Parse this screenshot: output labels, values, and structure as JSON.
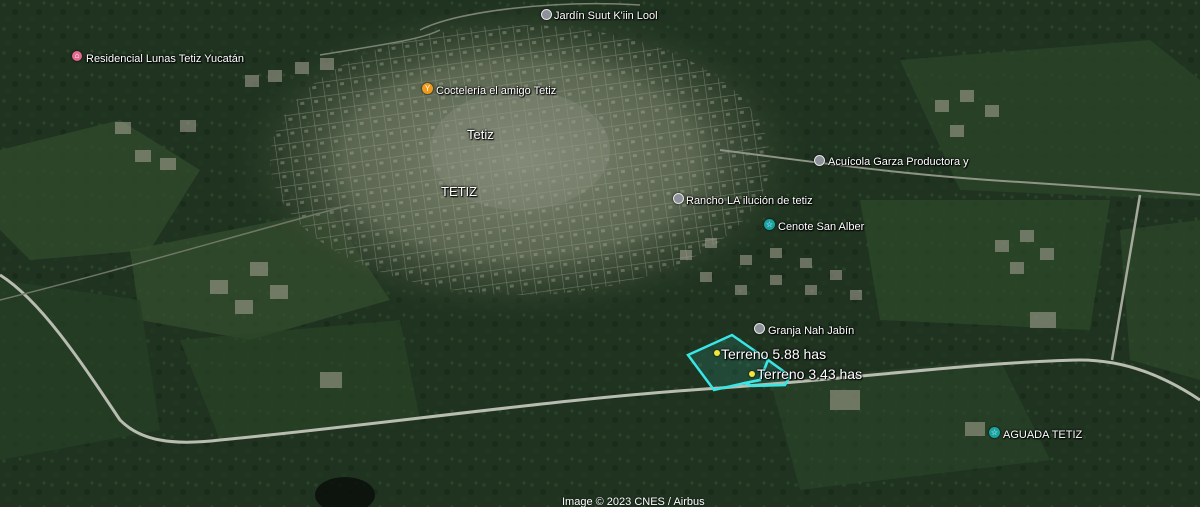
{
  "places": [
    {
      "key": "jardin",
      "label": "Jardín Suut K'iin Lool",
      "icon": "park-pin-icon",
      "color": "#8d9199"
    },
    {
      "key": "residencial",
      "label": "Residencial Lunas Tetiz Yucatán",
      "icon": "home-pin-icon",
      "color": "#e36a8e"
    },
    {
      "key": "cocteleria",
      "label": "Coctelería el amigo Tetiz",
      "icon": "restaurant-pin-icon",
      "color": "#f19a1a"
    },
    {
      "key": "tetiz1",
      "label": "Tetiz",
      "icon": "",
      "color": ""
    },
    {
      "key": "tetiz2",
      "label": "TETIZ",
      "icon": "",
      "color": ""
    },
    {
      "key": "acuicola",
      "label": "Acuícola Garza Productora y",
      "icon": "business-pin-icon",
      "color": "#8d9199"
    },
    {
      "key": "rancho",
      "label": "Rancho LA ilución de tetiz",
      "icon": "business-pin-icon",
      "color": "#8d9199"
    },
    {
      "key": "cenote",
      "label": "Cenote San Alber",
      "icon": "attraction-pin-icon",
      "color": "#1aa3a3"
    },
    {
      "key": "granja",
      "label": "Granja Nah Jabín",
      "icon": "business-pin-icon",
      "color": "#8d9199"
    },
    {
      "key": "aguada",
      "label": "AGUADA TETIZ",
      "icon": "attraction-pin-icon",
      "color": "#1aa3a3"
    }
  ],
  "parcels": [
    {
      "key": "p1",
      "label": "Terreno 5.88 has",
      "color": "#39e6e6"
    },
    {
      "key": "p2",
      "label": "Terreno 3.43 has",
      "color": "#39e6e6"
    }
  ],
  "credit": "Image © 2023 CNES / Airbus",
  "colors": {
    "forest": "#1f3320",
    "town": "#6b7560",
    "road": "#b9bcb0",
    "parcel_outline": "#39e6e6"
  }
}
